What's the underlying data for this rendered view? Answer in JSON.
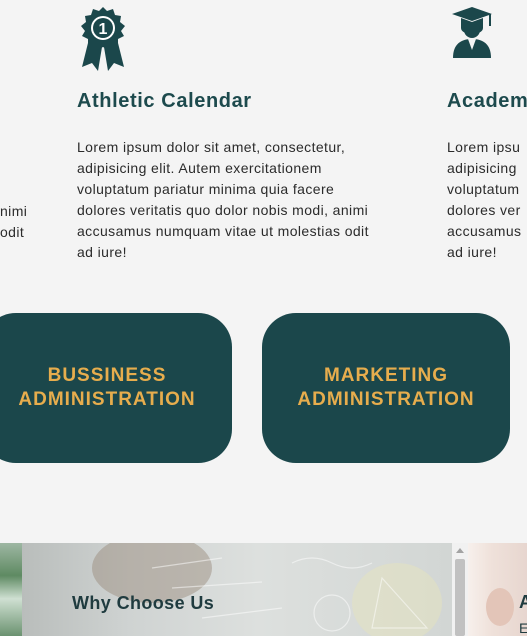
{
  "features": [
    {
      "title": "",
      "text_lines": [
        "",
        "",
        "nimi",
        "odit",
        ""
      ]
    },
    {
      "icon": "award-ribbon-icon",
      "badge": "1",
      "title": "Athletic Calendar",
      "text_lines": [
        "Lorem ipsum dolor sit amet, consectetur,",
        "adipisicing elit. Autem exercitationem",
        "voluptatum pariatur minima quia facere",
        "dolores veritatis quo dolor nobis modi, animi",
        "accusamus numquam vitae ut molestias odit",
        "ad iure!"
      ]
    },
    {
      "icon": "graduate-icon",
      "title": "Academ",
      "text_lines": [
        "Lorem ipsu",
        "adipisicing",
        "voluptatum",
        "dolores ver",
        "accusamus",
        "ad iure!"
      ]
    }
  ],
  "programs": [
    {
      "label": "BUSSINESS\nADMINISTRATION"
    },
    {
      "label": "MARKETING\nADMINISTRATION"
    }
  ],
  "bottom": {
    "why_title": "Why Choose Us",
    "right_partial_title": "A",
    "right_partial_text": "E"
  },
  "colors": {
    "teal": "#1b474b",
    "gold": "#e7ad4d",
    "background": "#f4f4f4"
  }
}
